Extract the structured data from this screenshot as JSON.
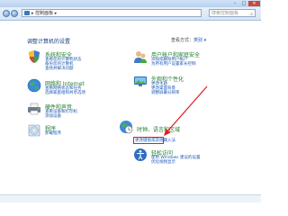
{
  "window": {
    "min": "–",
    "max": "□",
    "close": "✕"
  },
  "address": {
    "path": "▸ 控制面板 ▸",
    "search_placeholder": "搜索控制面板"
  },
  "heading": "调整计算机的设置",
  "view_by": {
    "label": "查看方式：",
    "value": "类别 ▾"
  },
  "categories": [
    {
      "title": "系统和安全",
      "links": [
        "查看您的计算机状态",
        "备份您的计算机",
        "查找并解决问题"
      ]
    },
    {
      "title": "网络和 Internet",
      "links": [
        "查看网络状态和任务",
        "选择家庭组和共享选项"
      ]
    },
    {
      "title": "硬件和声音",
      "links": [
        "查看设备和打印机",
        "添加设备"
      ]
    },
    {
      "title": "程序",
      "links": [
        "卸载程序"
      ]
    },
    {
      "title": "用户帐户和家庭安全",
      "links": [
        "添加或删除用户帐户",
        "为所有用户设置家长控制"
      ]
    },
    {
      "title": "外观和个性化",
      "links": [
        "更改主题",
        "更改桌面背景",
        "调整屏幕分辨率"
      ]
    },
    {
      "title": "时钟、语言和区域",
      "links": [
        "更改键盘或其他输入法"
      ]
    },
    {
      "title": "轻松访问",
      "links": [
        "使用 Windows 建议的设置",
        "优化视频显示"
      ]
    }
  ],
  "colors": {
    "title": "#1f7d2c",
    "link": "#1b57b3",
    "highlight": "#e21d1d"
  },
  "icons": [
    "shield-icon",
    "network-globe-icon",
    "printer-icon",
    "program-disc-icon",
    "users-icon",
    "appearance-icon",
    "clock-globe-icon",
    "ease-of-access-icon"
  ]
}
